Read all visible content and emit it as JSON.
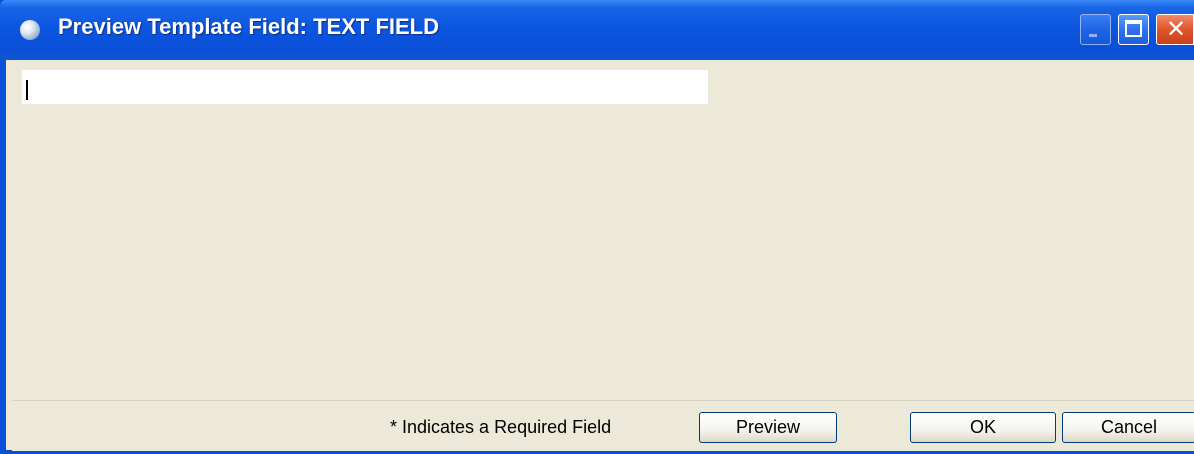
{
  "window": {
    "title": "Preview Template Field: TEXT FIELD",
    "icon": "app-globe-icon",
    "controls": {
      "minimize_icon": "minimize-icon",
      "maximize_icon": "maximize-icon",
      "close_icon": "close-icon",
      "close_glyph": "✕"
    },
    "colors": {
      "titlebar": "#0a4fd8",
      "close_button": "#e0552a",
      "body": "#ece9d8"
    }
  },
  "form": {
    "text_field": {
      "value": "",
      "placeholder": ""
    }
  },
  "footer": {
    "required_note": "* Indicates a Required Field",
    "preview_label": "Preview",
    "ok_label": "OK",
    "cancel_label": "Cancel"
  }
}
